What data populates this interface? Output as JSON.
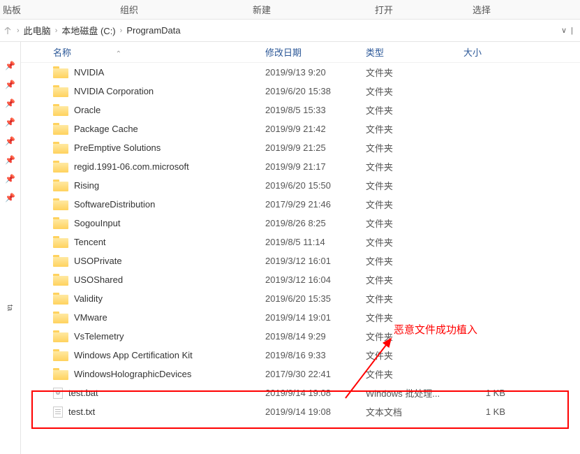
{
  "ribbon": {
    "items": [
      "贴板",
      "组织",
      "新建",
      "打开",
      "选择"
    ]
  },
  "breadcrumb": {
    "items": [
      "此电脑",
      "本地磁盘 (C:)",
      "ProgramData"
    ]
  },
  "columns": {
    "name": "名称",
    "date": "修改日期",
    "type": "类型",
    "size": "大小"
  },
  "sidebar": {
    "label": "ta"
  },
  "files": [
    {
      "icon": "folder",
      "name": "NVIDIA",
      "date": "2019/9/13 9:20",
      "type": "文件夹",
      "size": ""
    },
    {
      "icon": "folder",
      "name": "NVIDIA Corporation",
      "date": "2019/6/20 15:38",
      "type": "文件夹",
      "size": ""
    },
    {
      "icon": "folder",
      "name": "Oracle",
      "date": "2019/8/5 15:33",
      "type": "文件夹",
      "size": ""
    },
    {
      "icon": "folder",
      "name": "Package Cache",
      "date": "2019/9/9 21:42",
      "type": "文件夹",
      "size": ""
    },
    {
      "icon": "folder",
      "name": "PreEmptive Solutions",
      "date": "2019/9/9 21:25",
      "type": "文件夹",
      "size": ""
    },
    {
      "icon": "folder",
      "name": "regid.1991-06.com.microsoft",
      "date": "2019/9/9 21:17",
      "type": "文件夹",
      "size": ""
    },
    {
      "icon": "folder",
      "name": "Rising",
      "date": "2019/6/20 15:50",
      "type": "文件夹",
      "size": ""
    },
    {
      "icon": "folder",
      "name": "SoftwareDistribution",
      "date": "2017/9/29 21:46",
      "type": "文件夹",
      "size": ""
    },
    {
      "icon": "folder",
      "name": "SogouInput",
      "date": "2019/8/26 8:25",
      "type": "文件夹",
      "size": ""
    },
    {
      "icon": "folder",
      "name": "Tencent",
      "date": "2019/8/5 11:14",
      "type": "文件夹",
      "size": ""
    },
    {
      "icon": "folder",
      "name": "USOPrivate",
      "date": "2019/3/12 16:01",
      "type": "文件夹",
      "size": ""
    },
    {
      "icon": "folder",
      "name": "USOShared",
      "date": "2019/3/12 16:04",
      "type": "文件夹",
      "size": ""
    },
    {
      "icon": "folder",
      "name": "Validity",
      "date": "2019/6/20 15:35",
      "type": "文件夹",
      "size": ""
    },
    {
      "icon": "folder",
      "name": "VMware",
      "date": "2019/9/14 19:01",
      "type": "文件夹",
      "size": ""
    },
    {
      "icon": "folder",
      "name": "VsTelemetry",
      "date": "2019/8/14 9:29",
      "type": "文件夹",
      "size": ""
    },
    {
      "icon": "folder",
      "name": "Windows App Certification Kit",
      "date": "2019/8/16 9:33",
      "type": "文件夹",
      "size": ""
    },
    {
      "icon": "folder",
      "name": "WindowsHolographicDevices",
      "date": "2017/9/30 22:41",
      "type": "文件夹",
      "size": ""
    },
    {
      "icon": "bat",
      "name": "test.bat",
      "date": "2019/9/14 19:08",
      "type": "Windows 批处理...",
      "size": "1 KB"
    },
    {
      "icon": "txt",
      "name": "test.txt",
      "date": "2019/9/14 19:08",
      "type": "文本文档",
      "size": "1 KB"
    }
  ],
  "annotation": {
    "text": "恶意文件成功植入"
  }
}
